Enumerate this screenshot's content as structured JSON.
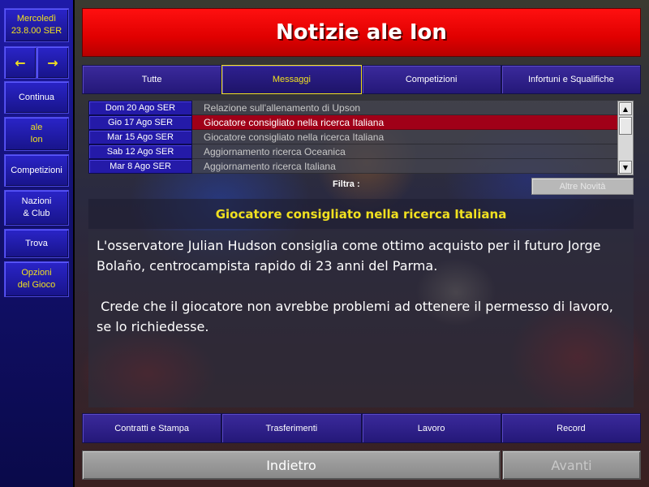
{
  "sidebar": {
    "date": {
      "weekday": "Mercoledì",
      "date": "23.8.00 SER"
    },
    "arrows": {
      "back": "←",
      "forward": "→"
    },
    "items": [
      {
        "label_line1": "Continua",
        "label_line2": "",
        "color": "white"
      },
      {
        "label_line1": "ale",
        "label_line2": "Ion",
        "color": "yellow"
      },
      {
        "label_line1": "Competizioni",
        "label_line2": "",
        "color": "white"
      },
      {
        "label_line1": "Nazioni",
        "label_line2": "& Club",
        "color": "white"
      },
      {
        "label_line1": "Trova",
        "label_line2": "",
        "color": "white"
      },
      {
        "label_line1": "Opzioni",
        "label_line2": "del Gioco",
        "color": "yellow"
      }
    ]
  },
  "header": {
    "title": "Notizie ale Ion"
  },
  "tabs": [
    {
      "label": "Tutte",
      "active": false
    },
    {
      "label": "Messaggi",
      "active": true
    },
    {
      "label": "Competizioni",
      "active": false
    },
    {
      "label": "Infortuni e Squalifiche",
      "active": false
    }
  ],
  "messages": [
    {
      "date": "Dom 20 Ago SER",
      "subject": "Relazione sull'allenamento di Upson",
      "selected": false
    },
    {
      "date": "Gio 17 Ago SER",
      "subject": "Giocatore consigliato nella ricerca Italiana",
      "selected": true
    },
    {
      "date": "Mar 15 Ago SER",
      "subject": "Giocatore consigliato nella ricerca Italiana",
      "selected": false
    },
    {
      "date": "Sab 12 Ago SER",
      "subject": "Aggiornamento ricerca Oceanica",
      "selected": false
    },
    {
      "date": "Mar 8 Ago SER",
      "subject": "Aggiornamento ricerca Italiana",
      "selected": false
    }
  ],
  "filter": {
    "label": "Filtra :",
    "other_news_button": "Altre Novità"
  },
  "selected_message": {
    "title": "Giocatore consigliato nella ricerca Italiana",
    "paragraph1": "L'osservatore Julian Hudson consiglia come ottimo acquisto per il futuro Jorge Bolaño, centrocampista rapido di 23 anni del Parma.",
    "paragraph2": " Crede che il giocatore non avrebbe problemi ad ottenere il permesso di lavoro, se lo richiedesse."
  },
  "bottom_tabs": [
    {
      "label": "Contratti e Stampa"
    },
    {
      "label": "Trasferimenti"
    },
    {
      "label": "Lavoro"
    },
    {
      "label": "Record"
    }
  ],
  "nav": {
    "back": "Indietro",
    "forward": "Avanti"
  },
  "colors": {
    "header_red": "#e00000",
    "accent_yellow": "#f0e020",
    "tab_purple": "#2e2090",
    "selected_row": "#a00018",
    "sidebar_blue": "#1e1aa8"
  }
}
